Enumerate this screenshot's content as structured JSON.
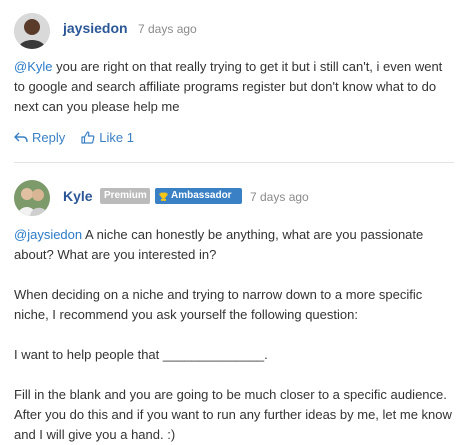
{
  "posts": [
    {
      "username": "jaysiedon",
      "time": "7 days ago",
      "mention": "@Kyle",
      "text": " you are right on that really trying to get it but i still can't, i even went to google and search affiliate programs register but don't know what to do next can you please help me",
      "actions": {
        "reply": "Reply",
        "like": "Like 1"
      }
    },
    {
      "username": "Kyle",
      "badges": {
        "premium": "Premium",
        "ambassador": "Ambassador"
      },
      "time": "7 days ago",
      "mention": "@jaysiedon",
      "p1": " A niche can honestly be anything, what are you passionate about? What are you interested in?",
      "p2": "When deciding on a niche and trying to narrow down to a more specific niche, I recommend you ask yourself the following question:",
      "p3": "I want to help people that ______________.",
      "p4": "Fill in the blank and you are going to be much closer to a specific audience. After you do this and if you want to run any further ideas by me, let me know and I will give you a hand. :)"
    }
  ],
  "colors": {
    "link": "#2b7bc8",
    "username": "#2b5797",
    "ambassador": "#3a80c4",
    "premium": "#bbbbbb"
  },
  "icons": {
    "reply": "reply-arrow-icon",
    "like": "thumbs-up-icon",
    "badge": "trophy-icon"
  }
}
